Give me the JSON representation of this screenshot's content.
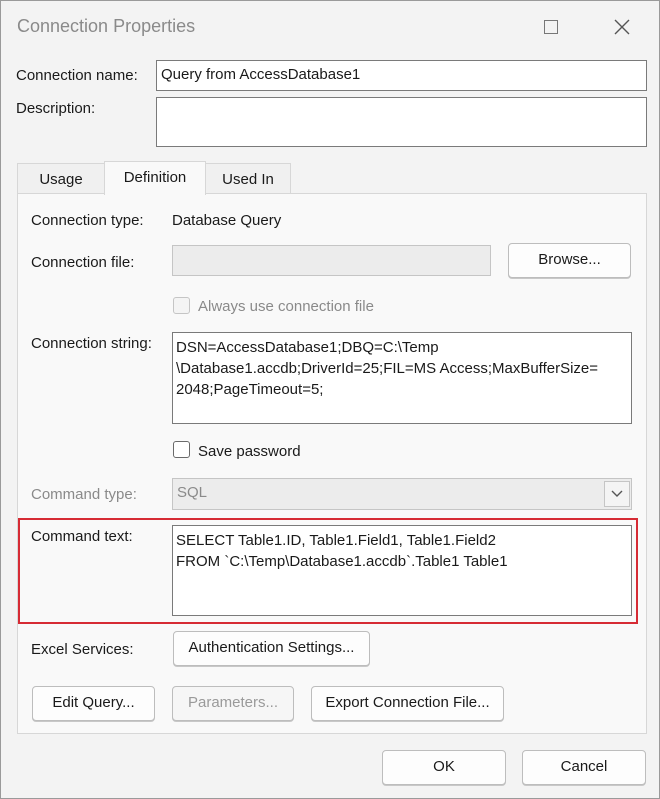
{
  "window": {
    "title": "Connection Properties",
    "maximize_icon": "maximize-icon",
    "close_icon": "close-icon"
  },
  "connection": {
    "name_label": "Connection name:",
    "name_value": "Query from AccessDatabase1",
    "description_label": "Description:",
    "description_value": ""
  },
  "tabs": [
    {
      "label": "Usage",
      "active": false
    },
    {
      "label": "Definition",
      "active": true
    },
    {
      "label": "Used In",
      "active": false
    }
  ],
  "definition": {
    "connection_type_label": "Connection type:",
    "connection_type_value": "Database Query",
    "connection_file_label": "Connection file:",
    "connection_file_value": "",
    "browse_button": "Browse...",
    "always_use_label": "Always use connection file",
    "connection_string_label": "Connection string:",
    "connection_string_value": "DSN=AccessDatabase1;DBQ=C:\\Temp\n\\Database1.accdb;DriverId=25;FIL=MS Access;MaxBufferSize=\n2048;PageTimeout=5;",
    "save_password_label": "Save password",
    "command_type_label": "Command type:",
    "command_type_value": "SQL",
    "command_text_label": "Command text:",
    "command_text_value": "SELECT Table1.ID, Table1.Field1, Table1.Field2\nFROM `C:\\Temp\\Database1.accdb`.Table1 Table1",
    "excel_services_label": "Excel Services:",
    "authentication_button": "Authentication Settings...",
    "edit_query_button": "Edit Query...",
    "parameters_button": "Parameters...",
    "export_button": "Export Connection File..."
  },
  "footer": {
    "ok_button": "OK",
    "cancel_button": "Cancel"
  },
  "colors": {
    "highlight": "#d62b34"
  }
}
